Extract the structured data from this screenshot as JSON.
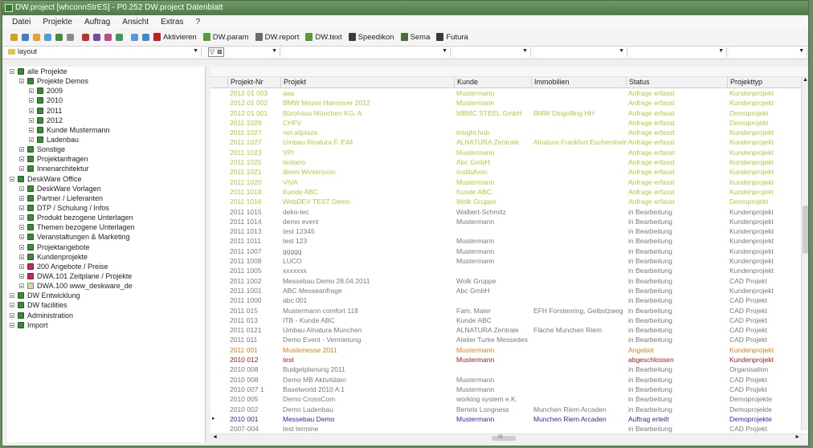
{
  "window": {
    "title": "DW.project [whconnStrES] - P0.252 DW.project Datenblatt"
  },
  "menu": [
    "Datei",
    "Projekte",
    "Auftrag",
    "Ansicht",
    "Extras",
    "?"
  ],
  "toolbar": {
    "icon_colors": [
      "#d9a020",
      "#3b82c4",
      "#e8a030",
      "#4aa0d8",
      "#4a8a3a",
      "#8a8a8a",
      "#c03030",
      "#7a4aa0",
      "#c04a8a",
      "#3a9a5a",
      "#5a9ad8",
      "#3a8ad0"
    ],
    "buttons": [
      {
        "label": "Aktivieren",
        "icon": "exclamation-icon",
        "color": "#c02020"
      },
      {
        "label": "DW.param",
        "icon": "dw-param-icon",
        "color": "#5a9a3a"
      },
      {
        "label": "DW.report",
        "icon": "document-icon",
        "color": "#6a6a6a"
      },
      {
        "label": "DW.text",
        "icon": "dw-text-icon",
        "color": "#5a9a3a"
      },
      {
        "label": "Speedikon",
        "icon": "pen-icon",
        "color": "#3a3a3a"
      },
      {
        "label": "Sema",
        "icon": "sema-icon",
        "color": "#4a6a3a"
      },
      {
        "label": "Futura",
        "icon": "arrow-icon",
        "color": "#3a3a3a"
      }
    ]
  },
  "layout_filter": {
    "value": "layout"
  },
  "tree": [
    {
      "label": "alle Projekte",
      "level": 0,
      "icon": "project-icon",
      "color": "#3a8a3a"
    },
    {
      "label": "Projekte Demos",
      "level": 1,
      "icon": "project-icon",
      "color": "#3a8a3a"
    },
    {
      "label": "2009",
      "level": 2,
      "icon": "project-icon",
      "color": "#3a8a3a"
    },
    {
      "label": "2010",
      "level": 2,
      "icon": "project-icon",
      "color": "#3a8a3a"
    },
    {
      "label": "2011",
      "level": 2,
      "icon": "project-icon",
      "color": "#3a8a3a"
    },
    {
      "label": "2012",
      "level": 2,
      "icon": "project-icon",
      "color": "#3a8a3a"
    },
    {
      "label": "Kunde Mustermann",
      "level": 2,
      "icon": "project-icon",
      "color": "#3a8a3a"
    },
    {
      "label": "Ladenbau",
      "level": 2,
      "icon": "project-icon",
      "color": "#3a8a3a"
    },
    {
      "label": "Sonstige",
      "level": 1,
      "icon": "project-icon",
      "color": "#3a8a3a"
    },
    {
      "label": "Projektanfragen",
      "level": 1,
      "icon": "project-icon",
      "color": "#3a8a3a"
    },
    {
      "label": "Innenarchitektur",
      "level": 1,
      "icon": "project-icon",
      "color": "#3a8a3a"
    },
    {
      "label": "DeskWare Office",
      "level": 0,
      "icon": "project-icon",
      "color": "#3a8a3a"
    },
    {
      "label": "DeskWare Vorlagen",
      "level": 1,
      "icon": "project-icon",
      "color": "#3a8a3a"
    },
    {
      "label": "Partner / Lieferanten",
      "level": 1,
      "icon": "project-icon",
      "color": "#3a8a3a"
    },
    {
      "label": "DTP / Schulung / Infos",
      "level": 1,
      "icon": "project-icon",
      "color": "#3a8a3a"
    },
    {
      "label": "Produkt bezogene Unterlagen",
      "level": 1,
      "icon": "project-icon",
      "color": "#3a8a3a"
    },
    {
      "label": "Themen bezogene Unterlagen",
      "level": 1,
      "icon": "project-icon",
      "color": "#3a8a3a"
    },
    {
      "label": "Veranstaltungen & Marketing",
      "level": 1,
      "icon": "project-icon",
      "color": "#3a8a3a"
    },
    {
      "label": "Projektangebote",
      "level": 1,
      "icon": "project-icon",
      "color": "#3a8a3a"
    },
    {
      "label": "Kundenprojekte",
      "level": 1,
      "icon": "project-icon",
      "color": "#3a8a3a"
    },
    {
      "label": "200 Angebote / Preise",
      "level": 1,
      "icon": "project-icon",
      "color": "#c02a5a"
    },
    {
      "label": "DWA.101 Zeitplane / Projekte",
      "level": 1,
      "icon": "project-icon",
      "color": "#c02a5a"
    },
    {
      "label": "DWA.100 www_deskware_de",
      "level": 1,
      "icon": "folder-icon",
      "color": "#d8d8a0"
    },
    {
      "label": "DW Entwicklung",
      "level": 0,
      "icon": "project-icon",
      "color": "#3a8a3a"
    },
    {
      "label": "DW facilities",
      "level": 0,
      "icon": "project-icon",
      "color": "#3a8a3a"
    },
    {
      "label": "Administration",
      "level": 0,
      "icon": "project-icon",
      "color": "#3a8a3a"
    },
    {
      "label": "Import",
      "level": 0,
      "icon": "project-icon",
      "color": "#3a8a3a"
    }
  ],
  "table": {
    "columns": [
      "Projekt-Nr",
      "Projekt",
      "Kunde",
      "Immobilien",
      "Status",
      "Projekttyp"
    ],
    "rows": [
      {
        "c": [
          "2012 01 003",
          "aaa",
          "Mustermann",
          "",
          "Anfrage erfasst",
          "Kundenprojekt"
        ],
        "color": "#b8c83a"
      },
      {
        "c": [
          "2012 01 002",
          "BMW Messe Hannover 2012",
          "Mustermann",
          "",
          "Anfrage erfasst",
          "Kundenprojekt"
        ],
        "color": "#b8c83a"
      },
      {
        "c": [
          "2012 01 001",
          "Bürohaus München KG, A",
          "MBMC STEEL GmbH",
          "BMW Dingolfing HH",
          "Anfrage erfasst",
          "Demoprojekt"
        ],
        "color": "#b8c83a"
      },
      {
        "c": [
          "2011 1029",
          "CHFV",
          "",
          "",
          "Anfrage erfasst",
          "Demoprojekt"
        ],
        "color": "#b8c83a"
      },
      {
        "c": [
          "2011 1027",
          "net.allplaza",
          "insight.hub",
          "",
          "Anfrage erfasst",
          "Kundenprojekt"
        ],
        "color": "#b8c83a"
      },
      {
        "c": [
          "2011 1027",
          "Umbau Alnatura F. E44",
          "ALNATURA Zentrale",
          "Alnatura Frankfurt Eschersheim",
          "Anfrage erfasst",
          "Kundenprojekt"
        ],
        "color": "#b8c83a"
      },
      {
        "c": [
          "2011 1023",
          "VPI",
          "Mustermann",
          "",
          "Anfrage erfasst",
          "Kundenprojekt"
        ],
        "color": "#b8c83a"
      },
      {
        "c": [
          "2011 1025",
          "testano",
          "Abc GmbH",
          "",
          "Anfrage erfasst",
          "Kundenprojekt"
        ],
        "color": "#b8c83a"
      },
      {
        "c": [
          "2011 1021",
          "dieon Wintersvon",
          "Institutvon",
          "",
          "Anfrage erfasst",
          "Kundenprojekt"
        ],
        "color": "#b8c83a"
      },
      {
        "c": [
          "2011 1020",
          "VIVA",
          "Mustermann",
          "",
          "Anfrage erfasst",
          "Kundenprojekt"
        ],
        "color": "#b8c83a"
      },
      {
        "c": [
          "2011 1018",
          "Kunde ABC",
          "Kunde ABC",
          "",
          "Anfrage erfasst",
          "Kundenprojekt"
        ],
        "color": "#b8c83a"
      },
      {
        "c": [
          "2011 1016",
          "WebDEV TEST Demo",
          "Wolk Gruppe",
          "",
          "Anfrage erfasst",
          "Demoprojekt"
        ],
        "color": "#b8c83a"
      },
      {
        "c": [
          "2011 1015",
          "deko-tec",
          "Walbert-Schmitz",
          "",
          "in Bearbeitung",
          "Kundenprojekt"
        ],
        "color": "#7a7a7a"
      },
      {
        "c": [
          "2011 1014",
          "demo event",
          "Mustermann",
          "",
          "in Bearbeitung",
          "Kundenprojekt"
        ],
        "color": "#7a7a7a"
      },
      {
        "c": [
          "2011 1013",
          "test 12345",
          "",
          "",
          "in Bearbeitung",
          "Kundenprojekt"
        ],
        "color": "#7a7a7a"
      },
      {
        "c": [
          "2011 1011",
          "test 123",
          "Mustermann",
          "",
          "in Bearbeitung",
          "Kundenprojekt"
        ],
        "color": "#7a7a7a"
      },
      {
        "c": [
          "2011 1007",
          "ggggg",
          "Mustermann",
          "",
          "in Bearbeitung",
          "Kundenprojekt"
        ],
        "color": "#7a7a7a"
      },
      {
        "c": [
          "2011 1008",
          "LUCO",
          "Mustermann",
          "",
          "in Bearbeitung",
          "Kundenprojekt"
        ],
        "color": "#7a7a7a"
      },
      {
        "c": [
          "2011 1005",
          "xxxxxxx",
          "",
          "",
          "in Bearbeitung",
          "Kundenprojekt"
        ],
        "color": "#7a7a7a"
      },
      {
        "c": [
          "2011 1002",
          "Messebau Demo 28.04.2011",
          "Wolk Gruppe",
          "",
          "in Bearbeitung",
          "CAD Projekt"
        ],
        "color": "#7a7a7a"
      },
      {
        "c": [
          "2011 1001",
          "ABC Messeanfrage",
          "Abc GmbH",
          "",
          "in Bearbeitung",
          "Kundenprojekt"
        ],
        "color": "#7a7a7a"
      },
      {
        "c": [
          "2011 1000",
          "abc 001",
          "",
          "",
          "in Bearbeitung",
          "CAD Projekt"
        ],
        "color": "#7a7a7a"
      },
      {
        "c": [
          "2011 015",
          "Mustermann comfort 118",
          "Fam. Maier",
          "EFH Forstenring, Gelbstzweg",
          "in Bearbeitung",
          "CAD Projekt"
        ],
        "color": "#7a7a7a"
      },
      {
        "c": [
          "2011 013",
          "ITB - Kunde ABC",
          "Kunde ABC",
          "",
          "in Bearbeitung",
          "CAD Projekt"
        ],
        "color": "#7a7a7a"
      },
      {
        "c": [
          "2011 0121",
          "Umbau Alnatura Munchen",
          "ALNATURA Zentrale",
          "Fläche Munchen Riem",
          "in Bearbeitung",
          "CAD Projekt"
        ],
        "color": "#7a7a7a"
      },
      {
        "c": [
          "2011 011",
          "Demo Event - Vermietung",
          "Atelier Turke Messedes",
          "",
          "in Bearbeitung",
          "CAD Projekt"
        ],
        "color": "#7a7a7a"
      },
      {
        "c": [
          "2011 001",
          "Musikmesse 2011",
          "Mustermann",
          "",
          "Angebot",
          "Kundenprojekt"
        ],
        "color": "#e0801a"
      },
      {
        "c": [
          "2010 012",
          "test",
          "Mustermann",
          "",
          "abgeschlossen",
          "Kundenprojekt"
        ],
        "color": "#a02020"
      },
      {
        "c": [
          "2010 008",
          "Budgetplanung 2011",
          "",
          "",
          "in Bearbeitung",
          "Organisation"
        ],
        "color": "#7a7a7a"
      },
      {
        "c": [
          "2010 008",
          "Demo MB Aktivitäten",
          "Mustermann",
          "",
          "in Bearbeitung",
          "CAD Projekt"
        ],
        "color": "#7a7a7a"
      },
      {
        "c": [
          "2010 007 1",
          "Baselworld 2010 A 1",
          "Mustermann",
          "",
          "in Bearbeitung",
          "CAD Projekt"
        ],
        "color": "#7a7a7a"
      },
      {
        "c": [
          "2010 005",
          "Demo CrossCom",
          "working system e.K.",
          "",
          "in Bearbeitung",
          "Demoprojekte"
        ],
        "color": "#7a7a7a"
      },
      {
        "c": [
          "2010 002",
          "Demo Ladenbau",
          "Bertels Longness",
          "Munchen Riem Arcaden",
          "in Bearbeitung",
          "Demoprojekte"
        ],
        "color": "#7a7a7a"
      },
      {
        "c": [
          "2010 001",
          "Messebau Demo",
          "Mustermann",
          "Munchen Riem Arcaden",
          "Auftrag erteilt",
          "Demoprojekte"
        ],
        "color": "#2a2ab8"
      },
      {
        "c": [
          "2007-004",
          "test termine",
          "",
          "",
          "in Bearbeitung",
          "CAD Projekt"
        ],
        "color": "#7a7a7a"
      }
    ]
  },
  "scrollbar": {
    "h_label": "III"
  }
}
